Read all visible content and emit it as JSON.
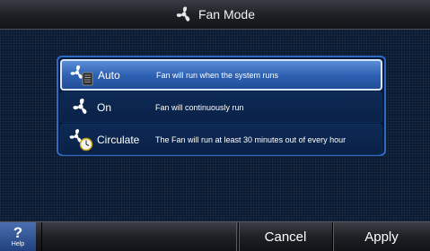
{
  "header": {
    "title": "Fan Mode",
    "icon": "fan-icon"
  },
  "options": [
    {
      "label": "Auto",
      "description": "Fan will run when the system runs",
      "icon": "fan-auto-icon",
      "selected": true
    },
    {
      "label": "On",
      "description": "Fan will continuously run",
      "icon": "fan-icon",
      "selected": false
    },
    {
      "label": "Circulate",
      "description": "The Fan will run at least  30  minutes out of every hour",
      "icon": "fan-clock-icon",
      "selected": false
    }
  ],
  "footer": {
    "help_symbol": "?",
    "help_label": "Help",
    "cancel_label": "Cancel",
    "apply_label": "Apply"
  },
  "colors": {
    "selected_option": "#3f74c4",
    "panel_border": "#2f6ac4",
    "background": "#0b1a2e"
  }
}
